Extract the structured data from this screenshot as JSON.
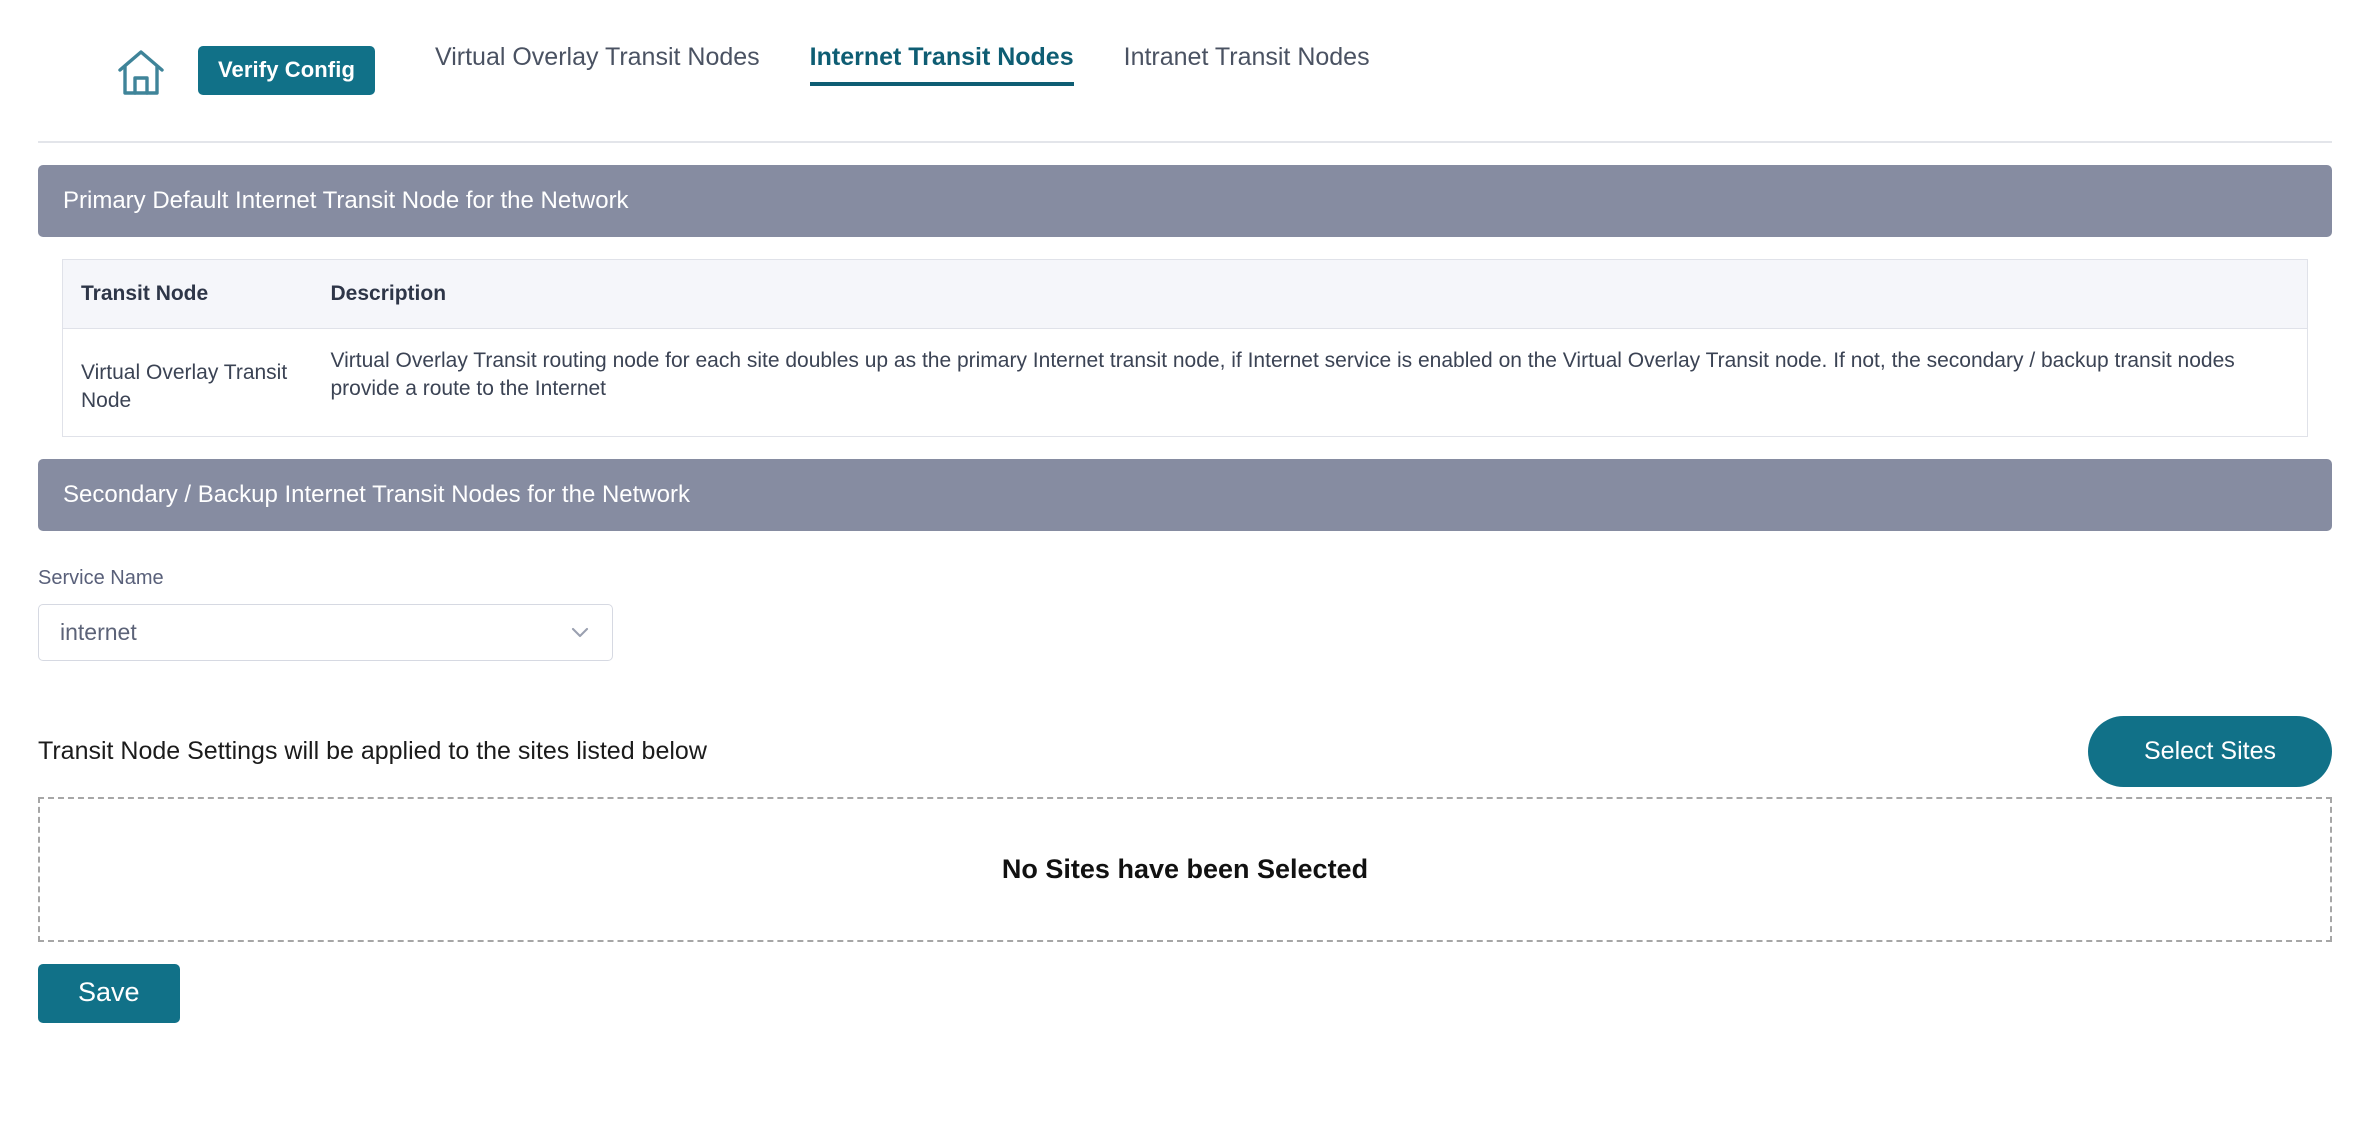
{
  "theme": {
    "accent_teal": "#117188",
    "active_tab_teal": "#0e5d73",
    "section_bar_gray": "#868ca1",
    "table_header_bg": "#f5f6fa",
    "dashed_border": "#a6a6a6"
  },
  "topnav": {
    "home_icon": "home-icon",
    "verify_button": "Verify Config",
    "tabs": [
      {
        "label": "Virtual Overlay Transit Nodes",
        "active": false
      },
      {
        "label": "Internet Transit Nodes",
        "active": true
      },
      {
        "label": "Intranet Transit Nodes",
        "active": false
      }
    ]
  },
  "primary_section": {
    "title": "Primary Default Internet Transit Node for the Network",
    "table": {
      "columns": [
        "Transit Node",
        "Description"
      ],
      "rows": [
        {
          "transit_node": "Virtual Overlay Transit Node",
          "description": "Virtual Overlay Transit routing node for each site doubles up as the primary Internet transit node, if Internet service is enabled on the Virtual Overlay Transit node. If not, the secondary / backup transit nodes provide a route to the Internet"
        }
      ]
    }
  },
  "secondary_section": {
    "title": "Secondary / Backup Internet Transit Nodes for the Network",
    "service_name": {
      "label": "Service Name",
      "value": "internet",
      "chevron_icon": "chevron-down-icon"
    },
    "apply_note": "Transit Node Settings will be applied to the sites listed below",
    "select_sites_button": "Select Sites",
    "empty_state": "No Sites have been Selected",
    "save_button": "Save"
  }
}
